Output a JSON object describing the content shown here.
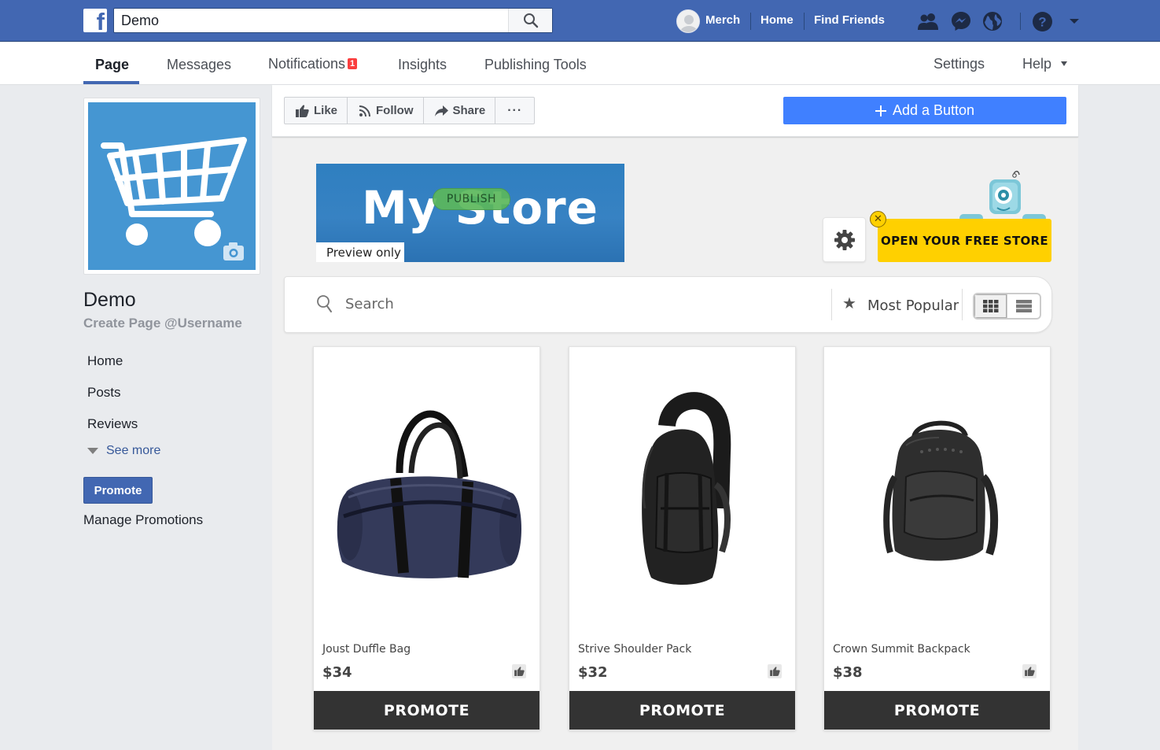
{
  "topbar": {
    "search_value": "Demo",
    "search_placeholder": "Search",
    "user_name": "Merch",
    "home_label": "Home",
    "find_friends_label": "Find Friends",
    "brand_color": "#4267b2"
  },
  "tabs": {
    "page": "Page",
    "messages": "Messages",
    "notifications": "Notifications",
    "notifications_count": "1",
    "insights": "Insights",
    "publishing_tools": "Publishing Tools",
    "settings": "Settings",
    "help": "Help"
  },
  "sidebar": {
    "page_name": "Demo",
    "username_link": "Create Page @Username",
    "links": [
      "Home",
      "Posts",
      "Reviews"
    ],
    "see_more": "See more",
    "promote_button": "Promote",
    "manage_promotions": "Manage Promotions"
  },
  "actions": {
    "like": "Like",
    "follow": "Follow",
    "share": "Share",
    "more": "···",
    "add_button": "Add a Button",
    "add_button_color": "#4080ff"
  },
  "store": {
    "banner_title": "My Store",
    "publish_label": "PUBLISH",
    "preview_label": "Preview only",
    "open_store_label": "OPEN YOUR FREE STORE",
    "close_label": "✕",
    "open_store_color": "#ffd000",
    "search_placeholder": "Search",
    "sort_label": "Most Popular",
    "products": [
      {
        "name": "Joust Duffle Bag",
        "price": "$34",
        "action": "PROMOTE"
      },
      {
        "name": "Strive Shoulder Pack",
        "price": "$32",
        "action": "PROMOTE"
      },
      {
        "name": "Crown Summit Backpack",
        "price": "$38",
        "action": "PROMOTE"
      }
    ]
  }
}
